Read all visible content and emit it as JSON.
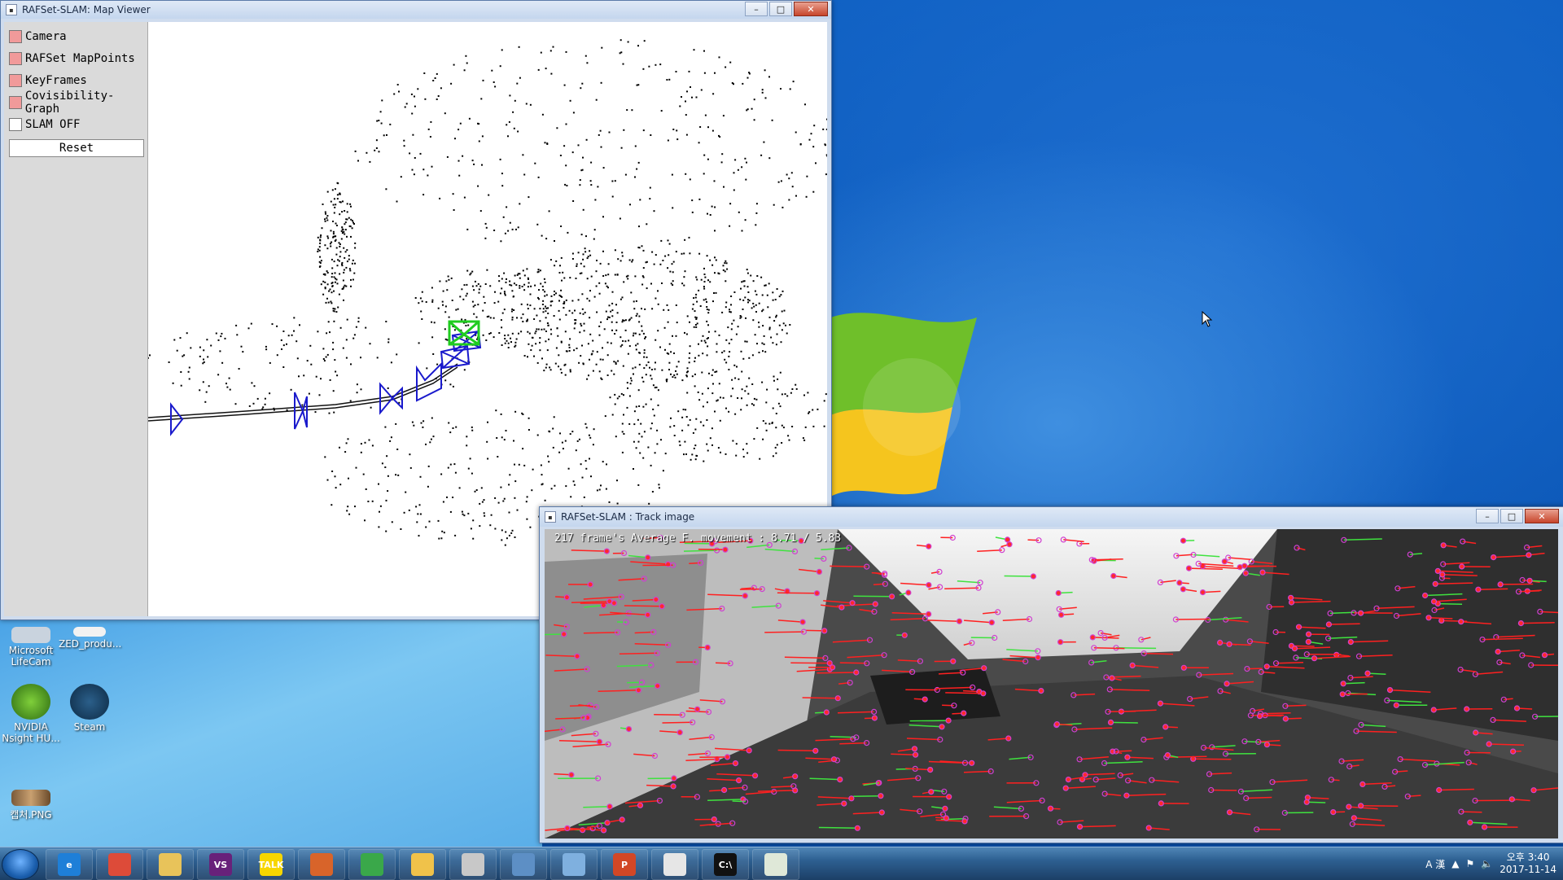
{
  "map_viewer": {
    "title": "RAFSet-SLAM: Map Viewer",
    "options": [
      {
        "label": "Camera",
        "checked": true
      },
      {
        "label": "RAFSet MapPoints",
        "checked": true
      },
      {
        "label": "KeyFrames",
        "checked": true
      },
      {
        "label": "Covisibility-Graph",
        "checked": true
      },
      {
        "label": "SLAM OFF",
        "checked": false
      }
    ],
    "reset_label": "Reset"
  },
  "track_window": {
    "title": "RAFSet-SLAM : Track image",
    "overlay_text": "217 frame's Average F. movement : 8.71 / 5.83"
  },
  "desktop_icons": [
    {
      "label": "Microsoft LifeCam"
    },
    {
      "label": "ZED_produ..."
    },
    {
      "label": "NVIDIA Nsight HU..."
    },
    {
      "label": "Steam"
    },
    {
      "label": "캡처.PNG"
    }
  ],
  "taskbar": {
    "items": [
      {
        "icon": "ie-icon",
        "label": "e",
        "color": "#1e7fd8"
      },
      {
        "icon": "chrome-icon",
        "label": "",
        "color": "#dd4b39"
      },
      {
        "icon": "explorer-icon",
        "label": "",
        "color": "#e8c35a"
      },
      {
        "icon": "visual-studio-icon",
        "label": "VS",
        "color": "#68217a"
      },
      {
        "icon": "kakaotalk-icon",
        "label": "TALK",
        "color": "#f7d600"
      },
      {
        "icon": "matlab-icon",
        "label": "",
        "color": "#d8642a"
      },
      {
        "icon": "app-icon",
        "label": "",
        "color": "#3aa84a"
      },
      {
        "icon": "folder-icon",
        "label": "",
        "color": "#f0c24a"
      },
      {
        "icon": "tool-icon",
        "label": "",
        "color": "#c8c8c8"
      },
      {
        "icon": "app2-icon",
        "label": "",
        "color": "#5d8fc5"
      },
      {
        "icon": "window-icon",
        "label": "",
        "color": "#7fb0df"
      },
      {
        "icon": "powerpoint-icon",
        "label": "P",
        "color": "#d24726"
      },
      {
        "icon": "paint-icon",
        "label": "",
        "color": "#e6e6e6"
      },
      {
        "icon": "cmd-icon",
        "label": "C:\\",
        "color": "#111111"
      },
      {
        "icon": "window2-icon",
        "label": "",
        "color": "#dfe8d8"
      }
    ],
    "tray_text": "A 漢",
    "clock_time": "오후 3:40",
    "clock_date": "2017-11-14"
  }
}
